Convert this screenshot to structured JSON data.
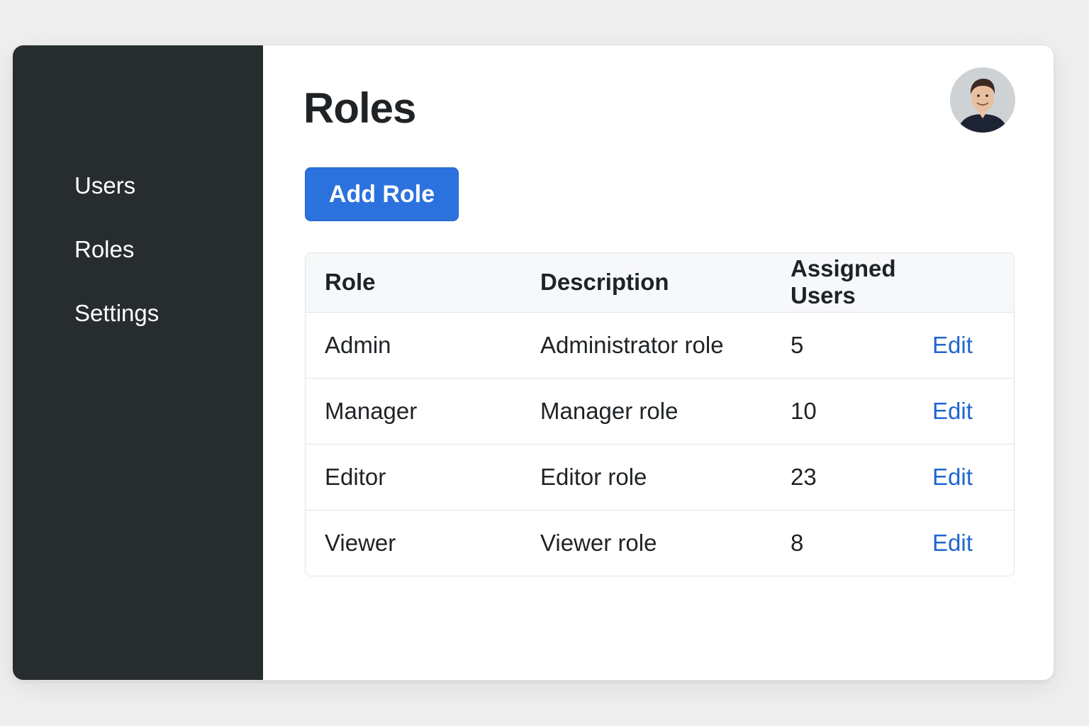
{
  "sidebar": {
    "items": [
      {
        "label": "Users"
      },
      {
        "label": "Roles"
      },
      {
        "label": "Settings"
      }
    ]
  },
  "header": {
    "title": "Roles",
    "avatar_icon": "user-avatar-photo"
  },
  "toolbar": {
    "add_label": "Add Role"
  },
  "table": {
    "columns": [
      "Role",
      "Description",
      "Assigned Users",
      ""
    ],
    "rows": [
      {
        "role": "Admin",
        "description": "Administrator role",
        "assigned": "5",
        "action": "Edit"
      },
      {
        "role": "Manager",
        "description": "Manager role",
        "assigned": "10",
        "action": "Edit"
      },
      {
        "role": "Editor",
        "description": "Editor role",
        "assigned": "23",
        "action": "Edit"
      },
      {
        "role": "Viewer",
        "description": "Viewer role",
        "assigned": "8",
        "action": "Edit"
      }
    ]
  },
  "colors": {
    "sidebar_bg": "#272c2f",
    "accent": "#2c72de",
    "link": "#1f66d1"
  }
}
